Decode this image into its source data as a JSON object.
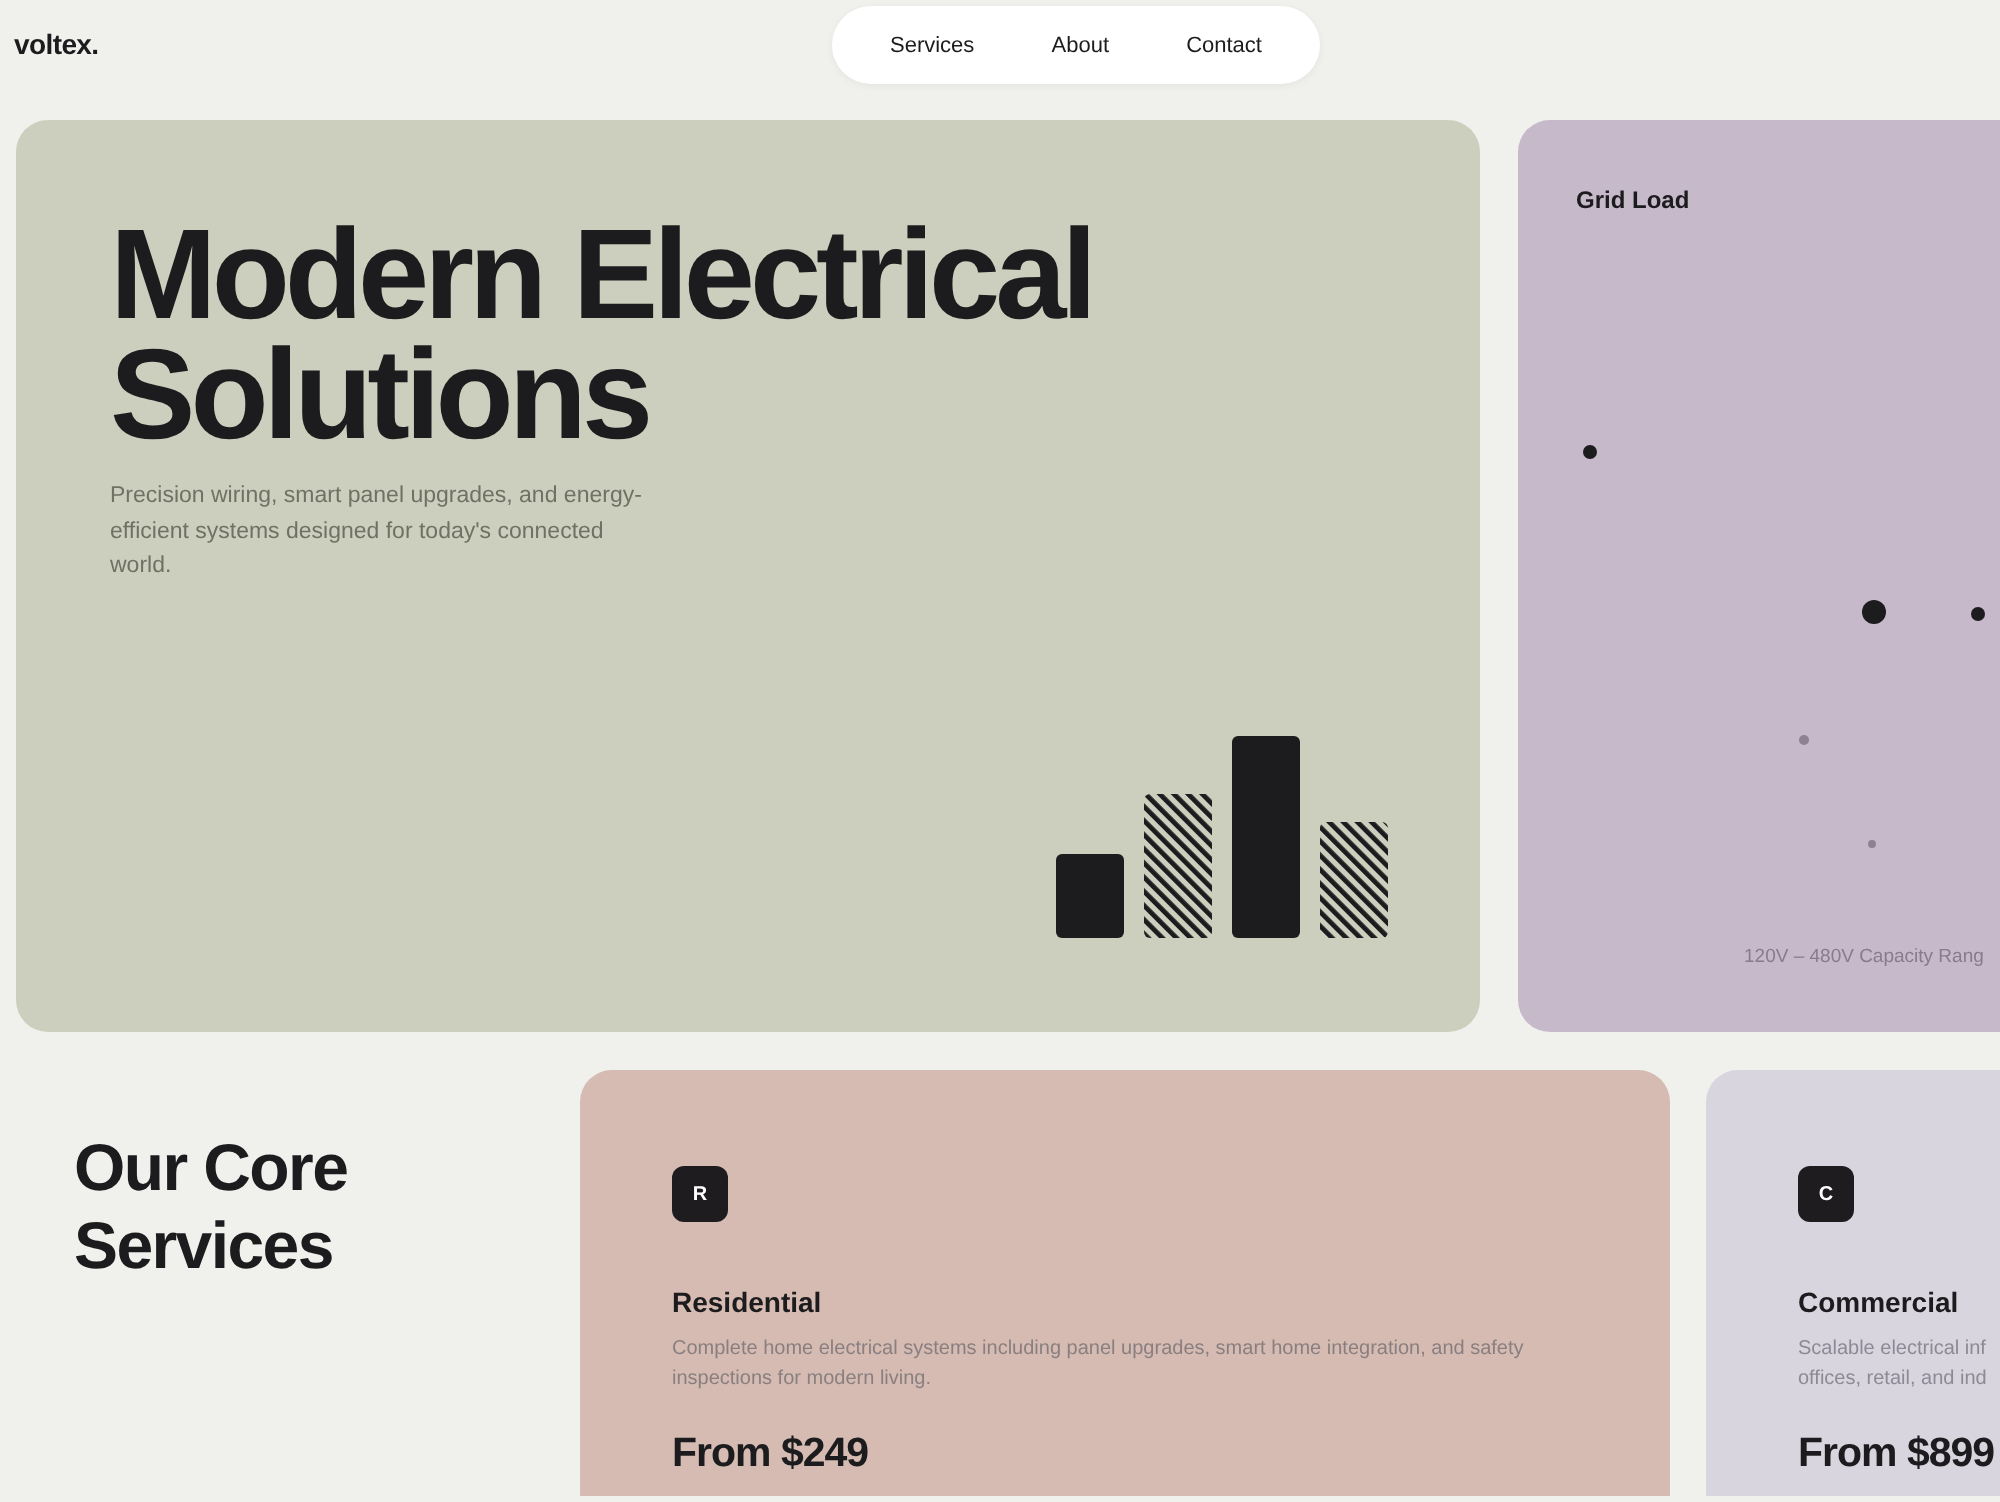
{
  "header": {
    "logo": "voltex.",
    "nav": [
      {
        "label": "Services"
      },
      {
        "label": "About"
      },
      {
        "label": "Contact"
      }
    ]
  },
  "hero": {
    "title": "Modern Electrical Solutions",
    "description": "Precision wiring, smart panel upgrades, and energy-efficient systems designed for today's connected world."
  },
  "grid_load": {
    "title": "Grid Load",
    "caption": "120V – 480V Capacity Rang"
  },
  "services": {
    "heading": "Our Core Services",
    "cards": [
      {
        "badge": "R",
        "title": "Residential",
        "description_lines": [
          "Complete home electrical systems including panel upgrades, smart home integration, and safety",
          "inspections for modern living."
        ],
        "price": "From $249"
      },
      {
        "badge": "C",
        "title": "Commercial",
        "description_lines": [
          "Scalable electrical inf",
          "offices, retail, and ind"
        ],
        "price": "From $899"
      }
    ]
  }
}
